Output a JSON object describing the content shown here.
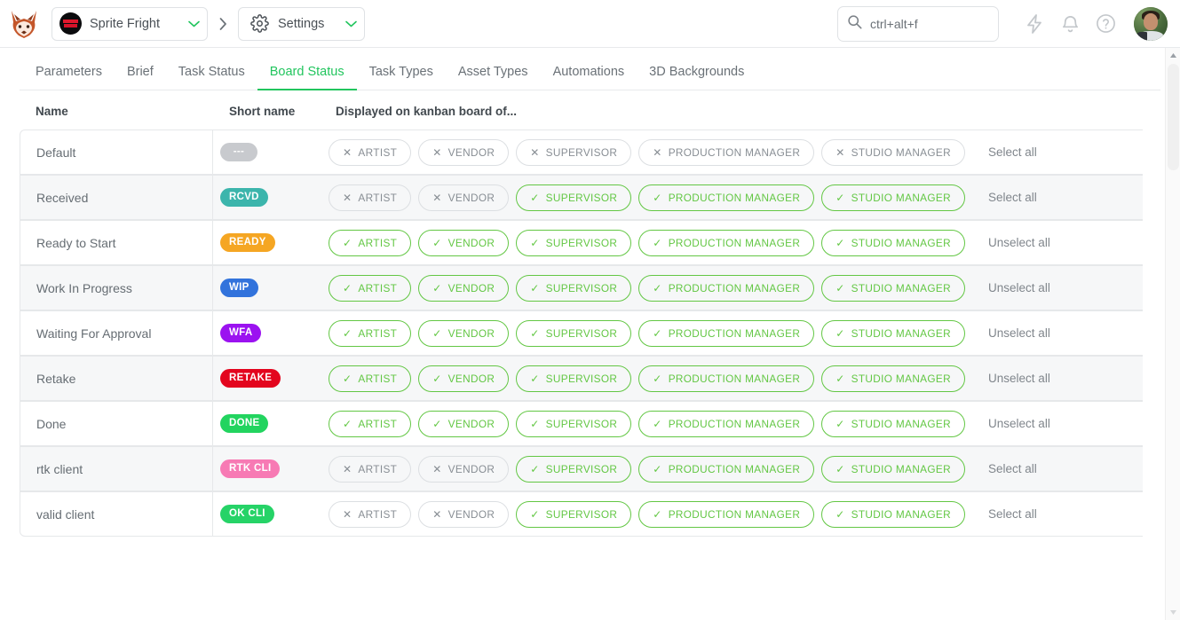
{
  "topbar": {
    "logo_icon": "fox-logo-icon",
    "project": {
      "name": "Sprite Fright",
      "chevron_icon": "chevron-down-icon"
    },
    "separator_icon": "chevron-right-icon",
    "section": {
      "name": "Settings",
      "gear_icon": "gear-icon",
      "chevron_icon": "chevron-down-icon"
    },
    "search": {
      "value": "",
      "placeholder": "ctrl+alt+f",
      "icon": "search-icon"
    },
    "icons": [
      {
        "name": "lightning-icon"
      },
      {
        "name": "bell-icon"
      },
      {
        "name": "help-circle-icon"
      }
    ],
    "avatar_name": "user-avatar"
  },
  "tabs": [
    {
      "label": "Parameters",
      "active": false
    },
    {
      "label": "Brief",
      "active": false
    },
    {
      "label": "Task Status",
      "active": false
    },
    {
      "label": "Board Status",
      "active": true
    },
    {
      "label": "Task Types",
      "active": false
    },
    {
      "label": "Asset Types",
      "active": false
    },
    {
      "label": "Automations",
      "active": false
    },
    {
      "label": "3D Backgrounds",
      "active": false
    }
  ],
  "table": {
    "headers": {
      "name": "Name",
      "short_name": "Short name",
      "displayed": "Displayed on kanban board of..."
    },
    "roles": [
      "ARTIST",
      "VENDOR",
      "SUPERVISOR",
      "PRODUCTION MANAGER",
      "STUDIO MANAGER"
    ],
    "select_all_label": "Select all",
    "unselect_all_label": "Unselect all",
    "check_glyph": "✓",
    "cross_glyph": "✕",
    "rows": [
      {
        "name": "Default",
        "short_name": "---",
        "short_color": "#c8cace",
        "roles": [
          false,
          false,
          false,
          false,
          false
        ],
        "action": "Select all"
      },
      {
        "name": "Received",
        "short_name": "RCVD",
        "short_color": "#3cb5ac",
        "roles": [
          false,
          false,
          true,
          true,
          true
        ],
        "action": "Select all"
      },
      {
        "name": "Ready to Start",
        "short_name": "READY",
        "short_color": "#f5a623",
        "roles": [
          true,
          true,
          true,
          true,
          true
        ],
        "action": "Unselect all"
      },
      {
        "name": "Work In Progress",
        "short_name": "WIP",
        "short_color": "#3273dc",
        "roles": [
          true,
          true,
          true,
          true,
          true
        ],
        "action": "Unselect all"
      },
      {
        "name": "Waiting For Approval",
        "short_name": "WFA",
        "short_color": "#9b12f0",
        "roles": [
          true,
          true,
          true,
          true,
          true
        ],
        "action": "Unselect all"
      },
      {
        "name": "Retake",
        "short_name": "RETAKE",
        "short_color": "#e3051e",
        "roles": [
          true,
          true,
          true,
          true,
          true
        ],
        "action": "Unselect all"
      },
      {
        "name": "Done",
        "short_name": "DONE",
        "short_color": "#22d45f",
        "roles": [
          true,
          true,
          true,
          true,
          true
        ],
        "action": "Unselect all"
      },
      {
        "name": "rtk client",
        "short_name": "RTK CLI",
        "short_color": "#f77ab4",
        "roles": [
          false,
          false,
          true,
          true,
          true
        ],
        "action": "Select all"
      },
      {
        "name": "valid client",
        "short_name": "OK CLI",
        "short_color": "#26d367",
        "roles": [
          false,
          false,
          true,
          true,
          true
        ],
        "action": "Select all"
      }
    ]
  },
  "colors": {
    "accent_green": "#22c55e",
    "chip_on": "#63c744",
    "chip_off_border": "#dcdfe2",
    "row_alt": "#f6f7f8"
  }
}
